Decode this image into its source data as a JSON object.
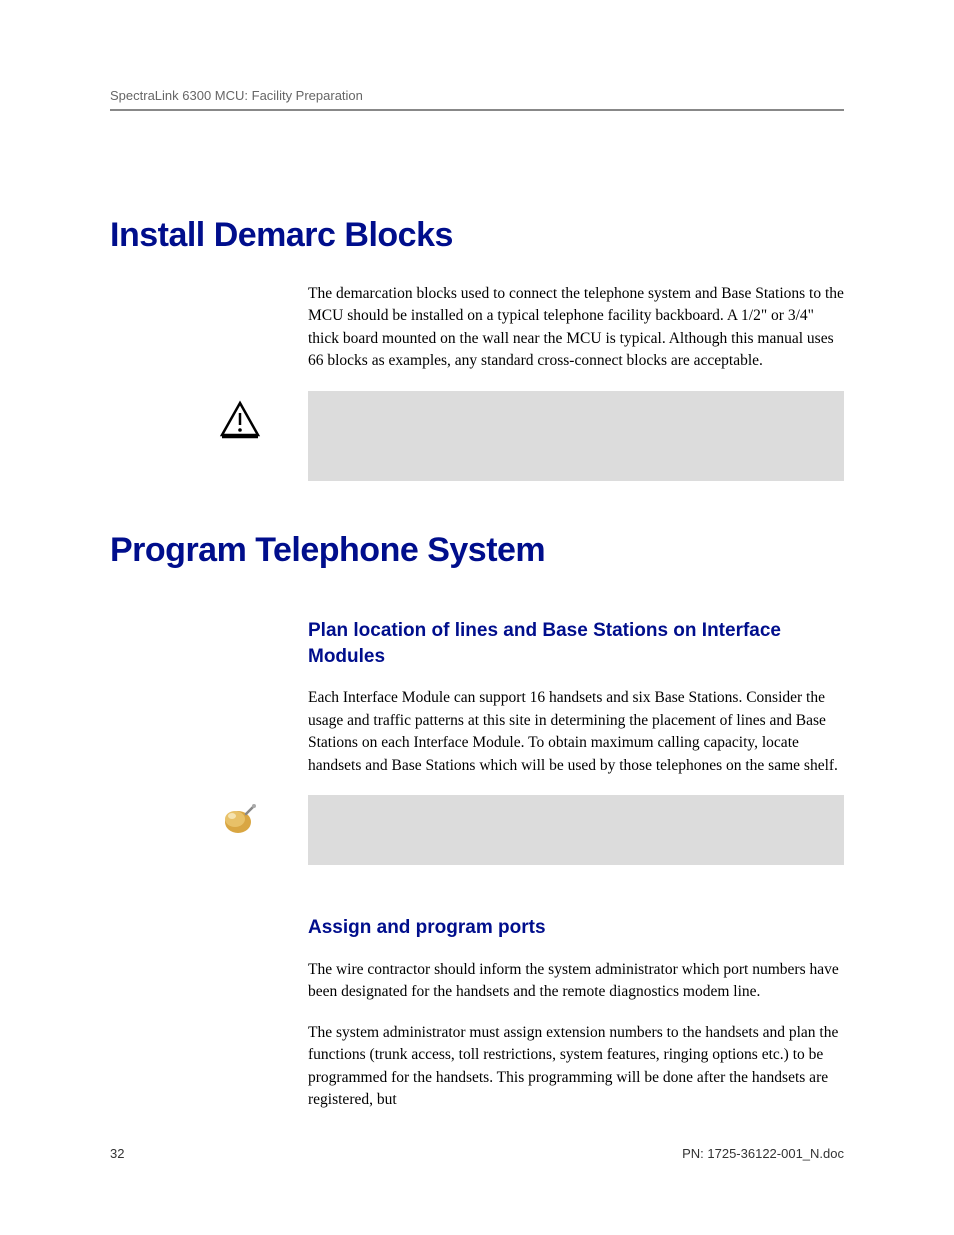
{
  "header": {
    "title": "SpectraLink 6300 MCU: Facility Preparation"
  },
  "sections": {
    "install": {
      "heading": "Install Demarc Blocks",
      "body": "The demarcation blocks used to connect the telephone system and Base Stations to the MCU should be installed on a typical telephone facility backboard. A 1/2\" or 3/4\" thick board mounted on the wall near the MCU is typical. Although this manual uses 66 blocks as examples, any standard cross-connect blocks are acceptable."
    },
    "program": {
      "heading": "Program Telephone System",
      "sub1": {
        "heading": "Plan location of lines and Base Stations on Interface Modules",
        "body": "Each Interface Module can support 16 handsets and six Base Stations. Consider the usage and traffic patterns at this site in determining the placement of lines and Base Stations on each Interface Module. To obtain maximum calling capacity, locate handsets and Base Stations which will be used by those telephones on the same shelf."
      },
      "sub2": {
        "heading": "Assign and program ports",
        "body1": "The wire contractor should inform the system administrator which port numbers have been designated for the handsets and the remote diagnostics modem line.",
        "body2": "The system administrator must assign extension numbers to the handsets and plan the functions (trunk access, toll restrictions, system features, ringing options etc.) to be programmed for the handsets. This programming will be done after the handsets are registered, but"
      }
    }
  },
  "footer": {
    "page": "32",
    "doc": "PN: 1725-36122-001_N.doc"
  },
  "icons": {
    "caution": "caution-triangle-icon",
    "note": "pushpin-icon"
  }
}
